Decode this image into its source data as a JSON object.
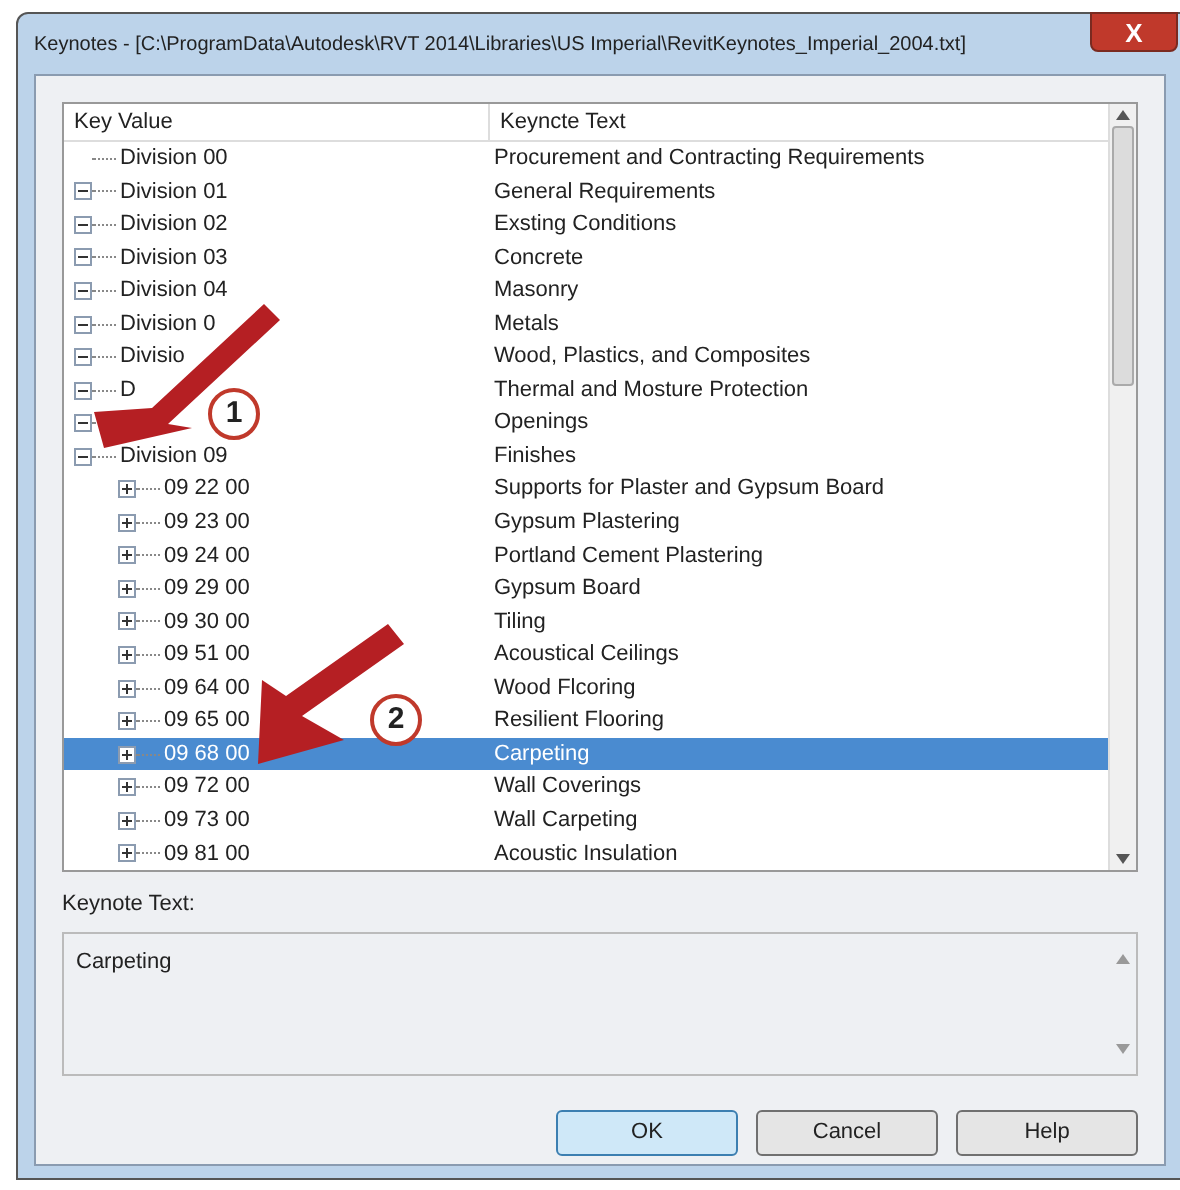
{
  "window": {
    "title": "Keynotes - [C:\\ProgramData\\Autodesk\\RVT 2014\\Libraries\\US Imperial\\RevitKeynotes_Imperial_2004.txt]",
    "close": "X"
  },
  "tree": {
    "columns": [
      "Key Value",
      "Keyncte Text"
    ],
    "rows": [
      {
        "key": "Division 00",
        "text": "Procurement and Contracting Requirements",
        "kind": "leaf",
        "selected": false
      },
      {
        "key": "Division 01",
        "text": "General Requirements",
        "kind": "node",
        "expanded": true,
        "selected": false
      },
      {
        "key": "Division 02",
        "text": "Exsting Conditions",
        "kind": "node",
        "expanded": true,
        "selected": false
      },
      {
        "key": "Division 03",
        "text": "Concrete",
        "kind": "node",
        "expanded": true,
        "selected": false
      },
      {
        "key": "Division 04",
        "text": "Masonry",
        "kind": "node",
        "expanded": true,
        "selected": false
      },
      {
        "key": "Division 0",
        "text": "Metals",
        "kind": "node",
        "expanded": true,
        "selected": false
      },
      {
        "key": "Divisio",
        "text": "Wood, Plastics, and Composites",
        "kind": "node",
        "expanded": true,
        "selected": false
      },
      {
        "key": "D",
        "text": "Thermal and Mosture Protection",
        "kind": "node",
        "expanded": true,
        "selected": false
      },
      {
        "text": "Openings",
        "kind": "node",
        "expanded": true,
        "selected": false
      },
      {
        "key": "Division 09",
        "text": "Finishes",
        "kind": "node",
        "expanded": true,
        "selected": false,
        "children": [
          {
            "key": "09 22 00",
            "text": "Supports for Plaster and Gypsum Board",
            "kind": "node",
            "expanded": false,
            "selected": false
          },
          {
            "key": "09 23 00",
            "text": "Gypsum Plastering",
            "kind": "node",
            "expanded": false,
            "selected": false
          },
          {
            "key": "09 24 00",
            "text": "Portland Cement Plastering",
            "kind": "node",
            "expanded": false,
            "selected": false
          },
          {
            "key": "09 29 00",
            "text": "Gypsum Board",
            "kind": "node",
            "expanded": false,
            "selected": false
          },
          {
            "key": "09 30 00",
            "text": "Tiling",
            "kind": "node",
            "expanded": false,
            "selected": false
          },
          {
            "key": "09 51 00",
            "text": "Acoustical Ceilings",
            "kind": "node",
            "expanded": false,
            "selected": false
          },
          {
            "key": "09 64 00",
            "text": "Wood Flcoring",
            "kind": "node",
            "expanded": false,
            "selected": false
          },
          {
            "key": "09 65 00",
            "text": "Resilient Flooring",
            "kind": "node",
            "expanded": false,
            "selected": false
          },
          {
            "key": "09 68 00",
            "text": "Carpeting",
            "kind": "node",
            "expanded": false,
            "selected": true
          },
          {
            "key": "09 72 00",
            "text": "Wall Coverings",
            "kind": "node",
            "expanded": false,
            "selected": false
          },
          {
            "key": "09 73 00",
            "text": "Wall Carpeting",
            "kind": "node",
            "expanded": false,
            "selected": false
          },
          {
            "key": "09 81 00",
            "text": "Acoustic Insulation",
            "kind": "node",
            "expanded": false,
            "selected": false
          }
        ]
      }
    ]
  },
  "keynote_text": {
    "label": "Keynote Text:",
    "value": "Carpeting"
  },
  "buttons": [
    {
      "label": "OK",
      "selected": true
    },
    {
      "label": "Cancel",
      "selected": false
    },
    {
      "label": "Help",
      "selected": false
    }
  ],
  "callouts": [
    "1",
    "2"
  ]
}
